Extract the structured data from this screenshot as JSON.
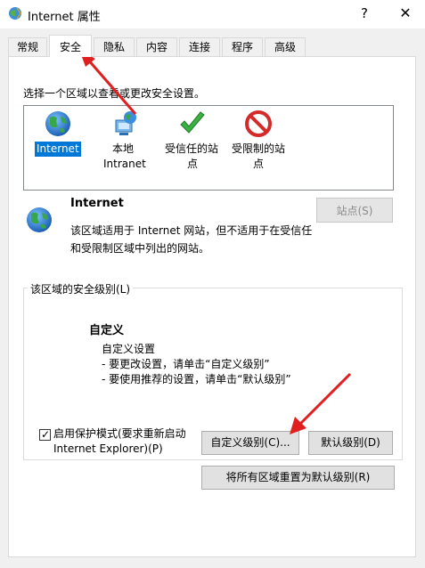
{
  "window": {
    "title": "Internet 属性",
    "help": "?",
    "close": "✕"
  },
  "tabs": [
    "常规",
    "安全",
    "隐私",
    "内容",
    "连接",
    "程序",
    "高级"
  ],
  "active_tab": "安全",
  "zones": {
    "instruction": "选择一个区域以查看或更改安全设置。",
    "items": [
      {
        "icon": "globe-icon",
        "lines": [
          "Internet"
        ],
        "selected": true
      },
      {
        "icon": "local-intranet-icon",
        "lines": [
          "本地",
          "Intranet"
        ],
        "selected": false
      },
      {
        "icon": "checkmark-icon",
        "lines": [
          "受信任的站",
          "点"
        ],
        "selected": false
      },
      {
        "icon": "no-entry-icon",
        "lines": [
          "受限制的站",
          "点"
        ],
        "selected": false
      }
    ]
  },
  "zone_info": {
    "title": "Internet",
    "desc_line1": "该区域适用于 Internet 网站，但不适用于在受信任",
    "desc_line2": "和受限制区域中列出的网站。",
    "sites_button": "站点(S)"
  },
  "security_level": {
    "legend": "该区域的安全级别(L)",
    "custom_title": "自定义",
    "lines": [
      "自定义设置",
      "- 要更改设置，请单击“自定义级别”",
      "- 要使用推荐的设置，请单击“默认级别”"
    ],
    "protected_mode_line1": "启用保护模式(要求重新启动",
    "protected_mode_line2": "Internet Explorer)(P)",
    "protected_mode_checked": true,
    "custom_level_button": "自定义级别(C)...",
    "default_level_button": "默认级别(D)"
  },
  "reset_button": "将所有区域重置为默认级别(R)",
  "colors": {
    "accent": "#0078d7",
    "arrow": "#e02020"
  }
}
